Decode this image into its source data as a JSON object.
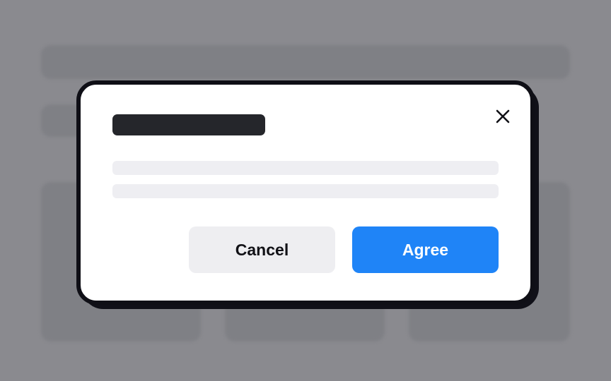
{
  "colors": {
    "backdrop": "#8a8a8f",
    "dialog_background": "#ffffff",
    "dialog_border": "#0f0f16",
    "primary_accent": "#1f84f7",
    "secondary_button": "#eeeef1"
  },
  "dialog": {
    "close_icon": "close-icon",
    "buttons": {
      "cancel_label": "Cancel",
      "agree_label": "Agree"
    }
  }
}
